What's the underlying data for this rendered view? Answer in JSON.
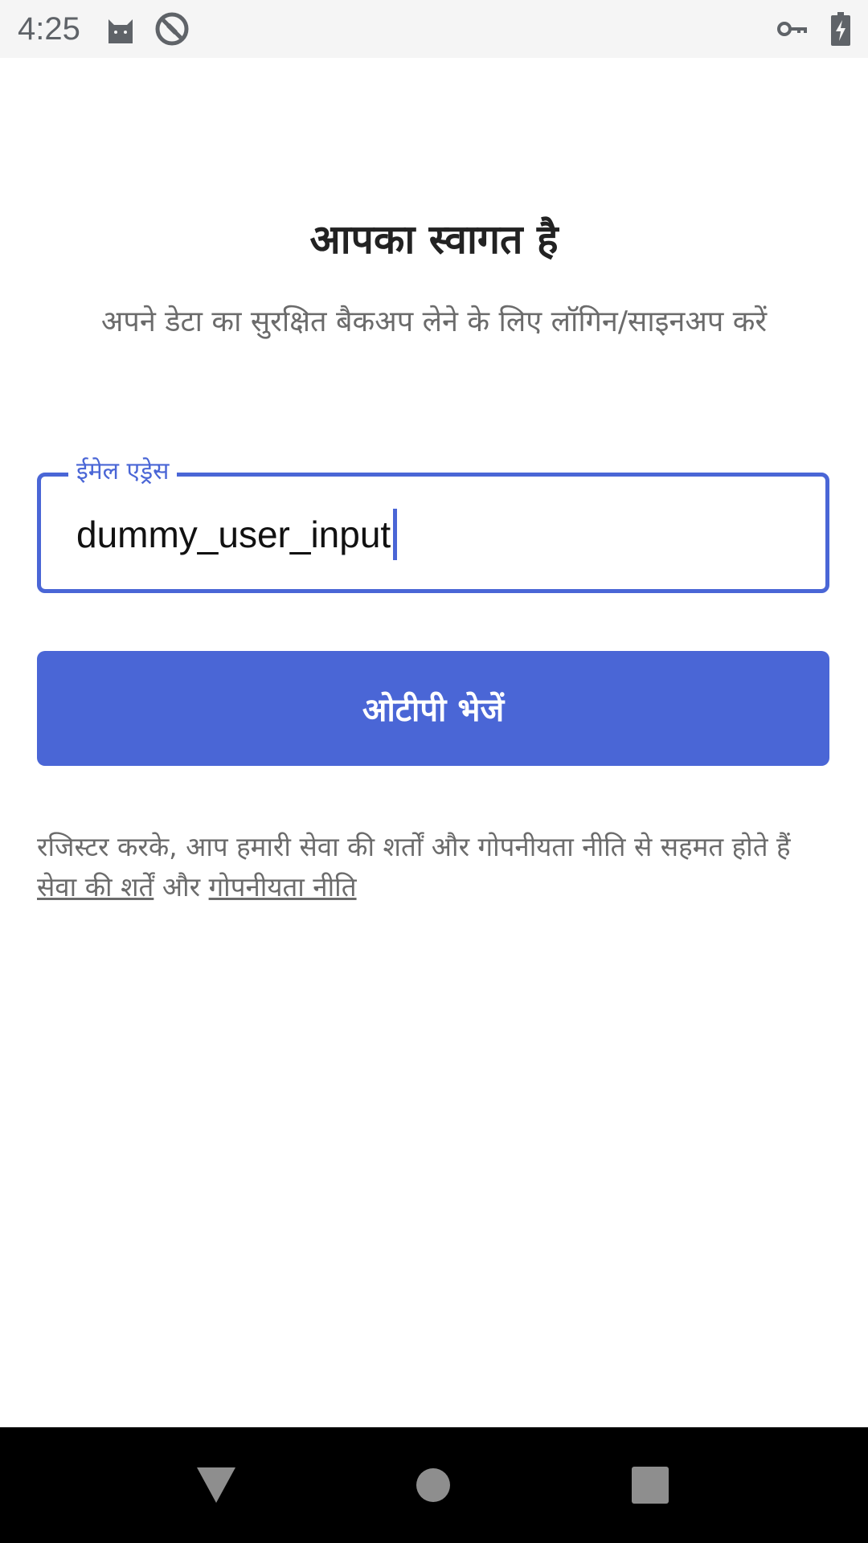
{
  "status_bar": {
    "time": "4:25",
    "left_icons": [
      "cat-notification-icon",
      "do-not-disturb-icon"
    ],
    "right_icons": [
      "vpn-key-icon",
      "battery-charging-icon"
    ]
  },
  "welcome": {
    "title": "आपका स्वागत है",
    "subtitle": "अपने डेटा का सुरक्षित बैकअप लेने के लिए लॉगिन/साइनअप करें"
  },
  "email_field": {
    "label": "ईमेल एड्रेस",
    "value": "dummy_user_input"
  },
  "otp_button": {
    "label": "ओटीपी भेजें"
  },
  "terms": {
    "text": "रजिस्टर करके, आप हमारी सेवा की शर्तों और गोपनीयता नीति से सहमत होते हैं",
    "terms_link": "सेवा की शर्तें",
    "and_text": "और",
    "privacy_link": "गोपनीयता नीति"
  },
  "nav_bar": {
    "buttons": [
      "back-icon",
      "home-icon",
      "recents-icon"
    ]
  },
  "colors": {
    "accent": "#4a66d6",
    "status_bar_bg": "#f5f5f5",
    "nav_bar_bg": "#000000"
  }
}
